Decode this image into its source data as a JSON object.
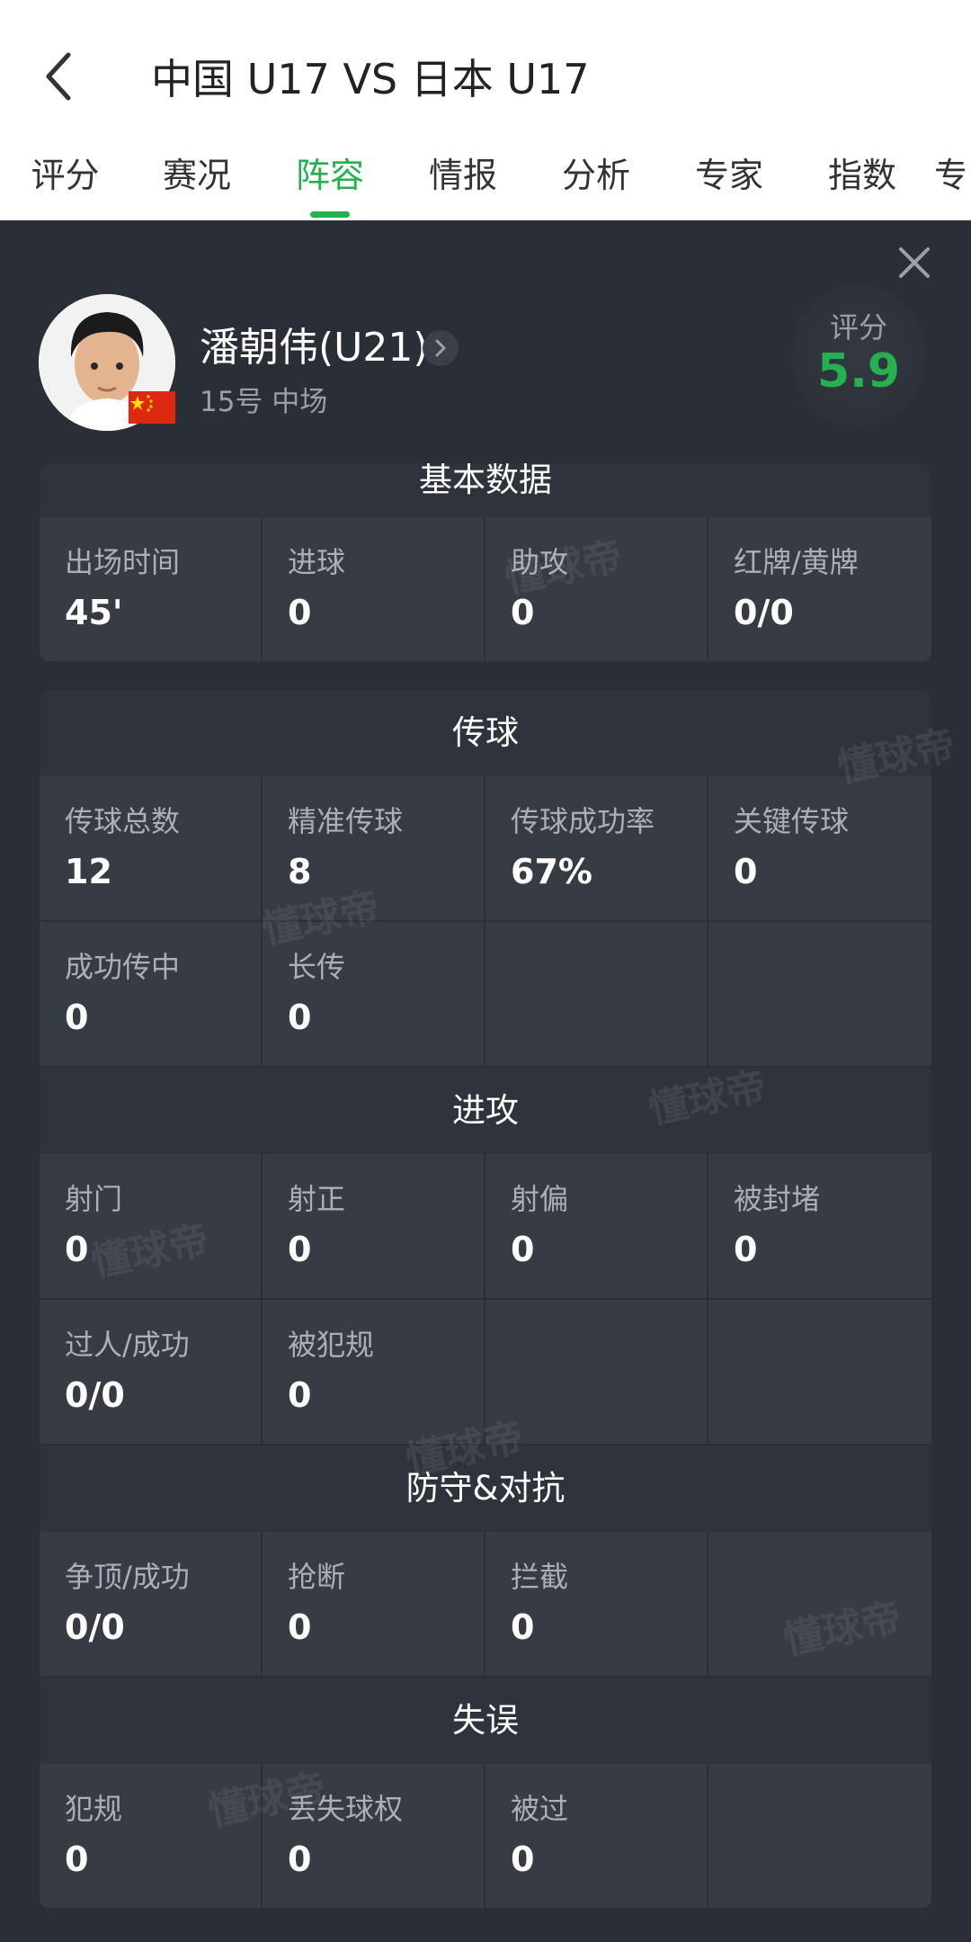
{
  "header": {
    "title": "中国 U17 VS 日本 U17",
    "tabs": [
      "评分",
      "赛况",
      "阵容",
      "情报",
      "分析",
      "专家",
      "指数"
    ],
    "active_tab": "阵容",
    "overflow_tab": "专"
  },
  "player": {
    "name": "潘朝伟(U21)",
    "meta": "15号  中场",
    "rating_label": "评分",
    "rating_value": "5.9"
  },
  "sections": {
    "basic": {
      "title": "基本数据",
      "cells": [
        {
          "label": "出场时间",
          "value": "45'"
        },
        {
          "label": "进球",
          "value": "0"
        },
        {
          "label": "助攻",
          "value": "0"
        },
        {
          "label": "红牌/黄牌",
          "value": "0/0"
        }
      ]
    },
    "passing": {
      "title": "传球",
      "cells": [
        {
          "label": "传球总数",
          "value": "12"
        },
        {
          "label": "精准传球",
          "value": "8"
        },
        {
          "label": "传球成功率",
          "value": "67%"
        },
        {
          "label": "关键传球",
          "value": "0"
        },
        {
          "label": "成功传中",
          "value": "0"
        },
        {
          "label": "长传",
          "value": "0"
        }
      ]
    },
    "attack": {
      "title": "进攻",
      "cells": [
        {
          "label": "射门",
          "value": "0"
        },
        {
          "label": "射正",
          "value": "0"
        },
        {
          "label": "射偏",
          "value": "0"
        },
        {
          "label": "被封堵",
          "value": "0"
        },
        {
          "label": "过人/成功",
          "value": "0/0"
        },
        {
          "label": "被犯规",
          "value": "0"
        }
      ]
    },
    "defense": {
      "title": "防守&对抗",
      "cells": [
        {
          "label": "争顶/成功",
          "value": "0/0"
        },
        {
          "label": "抢断",
          "value": "0"
        },
        {
          "label": "拦截",
          "value": "0"
        }
      ]
    },
    "errors": {
      "title": "失误",
      "cells": [
        {
          "label": "犯规",
          "value": "0"
        },
        {
          "label": "丢失球权",
          "value": "0"
        },
        {
          "label": "被过",
          "value": "0"
        }
      ]
    }
  },
  "watermark_text": "懂球帝",
  "colors": {
    "accent": "#24b24f",
    "panel_bg": "#2a2e36",
    "cell_bg": "#363b44"
  }
}
